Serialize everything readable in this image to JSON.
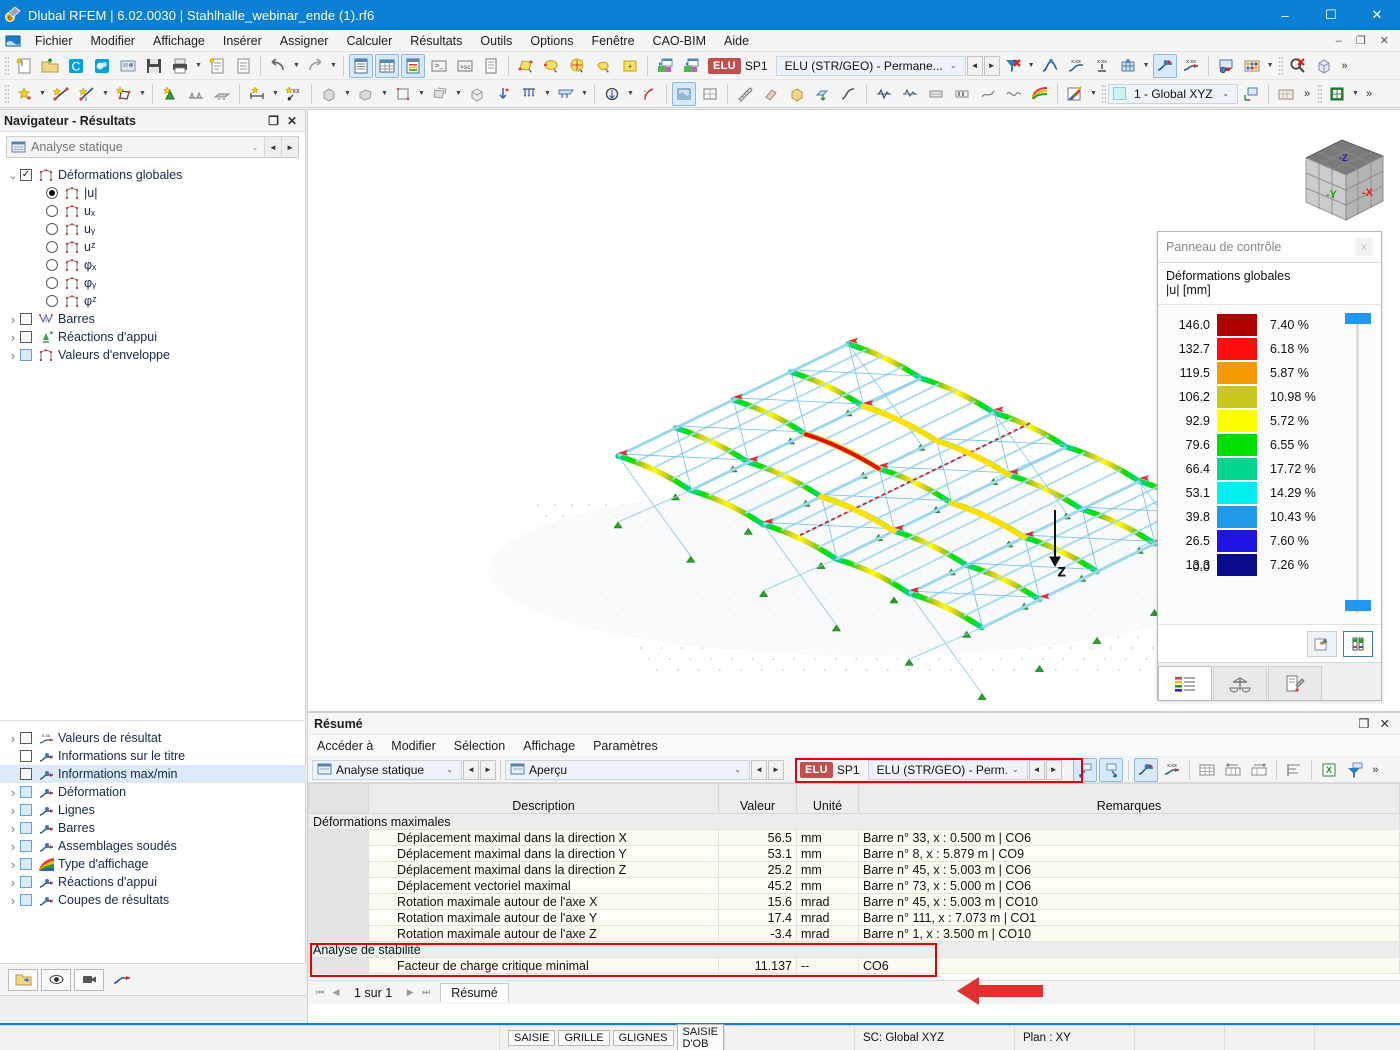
{
  "window": {
    "title": "Dlubal RFEM | 6.02.0030 | Stahlhalle_webinar_ende (1).rf6",
    "minimize": "–",
    "maximize": "☐",
    "close": "✕"
  },
  "menubar": {
    "items": [
      "Fichier",
      "Modifier",
      "Affichage",
      "Insérer",
      "Assigner",
      "Calculer",
      "Résultats",
      "Outils",
      "Options",
      "Fenêtre",
      "CAO-BIM",
      "Aide"
    ],
    "win_buttons": [
      "–",
      "❐",
      "✕"
    ]
  },
  "toolbar": {
    "load_badge": "ELU",
    "load_case": "SP1",
    "combination": "ELU (STR/GEO) - Permane...",
    "coord_system": "1 - Global XYZ",
    "prev_label": "◄",
    "next_label": "►",
    "chevron": "⌄",
    "overflow": "»"
  },
  "navigator": {
    "title": "Navigateur - Résultats",
    "restore_icon": "❐",
    "close_icon": "✕",
    "selector": "Analyse statique",
    "tree": [
      {
        "label": "Déformations globales",
        "type": "check",
        "checked": true,
        "expanded": true,
        "icon": "frame-icon",
        "indent": 0
      },
      {
        "label": "|u|",
        "type": "radio",
        "selected": true,
        "icon": "frame-icon",
        "indent": 1
      },
      {
        "label": "uₓ",
        "type": "radio",
        "selected": false,
        "icon": "frame-icon",
        "indent": 1
      },
      {
        "label": "uᵧ",
        "type": "radio",
        "selected": false,
        "icon": "frame-icon",
        "indent": 1
      },
      {
        "label": "uᶻ",
        "type": "radio",
        "selected": false,
        "icon": "frame-icon",
        "indent": 1
      },
      {
        "label": "φₓ",
        "type": "radio",
        "selected": false,
        "icon": "frame-icon",
        "indent": 1
      },
      {
        "label": "φᵧ",
        "type": "radio",
        "selected": false,
        "icon": "frame-icon",
        "indent": 1
      },
      {
        "label": "φᶻ",
        "type": "radio",
        "selected": false,
        "icon": "frame-icon",
        "indent": 1
      },
      {
        "label": "Barres",
        "type": "check",
        "checked": false,
        "expandable": true,
        "icon": "member-icon",
        "indent": 0
      },
      {
        "label": "Réactions d'appui",
        "type": "check",
        "checked": false,
        "expandable": true,
        "icon": "support-icon",
        "indent": 0
      },
      {
        "label": "Valeurs d'enveloppe",
        "type": "check",
        "checked": false,
        "blue": true,
        "expandable": true,
        "icon": "frame-icon",
        "indent": 0
      }
    ],
    "tree2": [
      {
        "label": "Valeurs de résultat",
        "expandable": true,
        "icon": "values-icon"
      },
      {
        "label": "Informations sur le titre",
        "expandable": false,
        "icon": "info-icon"
      },
      {
        "label": "Informations max/min",
        "expandable": false,
        "icon": "info-icon",
        "selected": true
      },
      {
        "label": "Déformation",
        "expandable": true,
        "icon": "info-icon",
        "blue": true
      },
      {
        "label": "Lignes",
        "expandable": true,
        "icon": "info-icon",
        "blue": true
      },
      {
        "label": "Barres",
        "expandable": true,
        "icon": "info-icon",
        "blue": true
      },
      {
        "label": "Assemblages soudés",
        "expandable": true,
        "icon": "info-icon",
        "blue": true
      },
      {
        "label": "Type d'affichage",
        "expandable": true,
        "icon": "rainbow-icon",
        "blue": true
      },
      {
        "label": "Réactions d'appui",
        "expandable": true,
        "icon": "info-icon",
        "blue": true
      },
      {
        "label": "Coupes de résultats",
        "expandable": true,
        "icon": "info-icon",
        "blue": true
      }
    ]
  },
  "control_panel": {
    "title": "Panneau de contrôle",
    "close_icon": "x",
    "heading_line1": "Déformations globales",
    "heading_line2": "|u| [mm]",
    "legend_values": [
      "146.0",
      "132.7",
      "119.5",
      "106.2",
      "92.9",
      "79.6",
      "66.4",
      "53.1",
      "39.8",
      "26.5",
      "13.3",
      "0.0"
    ],
    "legend_bands": [
      {
        "color": "#b00000",
        "percent": "7.40 %"
      },
      {
        "color": "#ff0d0d",
        "percent": "6.18 %"
      },
      {
        "color": "#f59a00",
        "percent": "5.87 %"
      },
      {
        "color": "#c8c81e",
        "percent": "10.98 %"
      },
      {
        "color": "#ffff00",
        "percent": "5.72 %"
      },
      {
        "color": "#00e000",
        "percent": "6.55 %"
      },
      {
        "color": "#00d68c",
        "percent": "17.72 %"
      },
      {
        "color": "#00f0f0",
        "percent": "14.29 %"
      },
      {
        "color": "#1e9ae6",
        "percent": "10.43 %"
      },
      {
        "color": "#1e14e6",
        "percent": "7.60 %"
      },
      {
        "color": "#0a0a8c",
        "percent": "7.26 %"
      }
    ],
    "slider_color": "#2196f3",
    "tabs": [
      "legend-tab",
      "scale-tab",
      "factors-tab"
    ]
  },
  "viewport": {
    "axis_labels": {
      "x": "X",
      "y": "Y",
      "z": "Z"
    },
    "load_arrow_label": "Z",
    "viewcube": {
      "left": "-Y",
      "right": "-X",
      "top": "-Z"
    }
  },
  "dock": {
    "title": "Résumé",
    "restore_icon": "❐",
    "close_icon": "✕",
    "menu": [
      "Accéder à",
      "Modifier",
      "Sélection",
      "Affichage",
      "Paramètres"
    ],
    "selector_left": "Analyse statique",
    "selector_mid": "Aperçu",
    "load_badge": "ELU",
    "load_case": "SP1",
    "combination": "ELU (STR/GEO) - Perm...",
    "columns": [
      "",
      "Description",
      "Valeur",
      "Unité",
      "Remarques"
    ],
    "group1": "Déformations maximales",
    "rows1": [
      {
        "description": "Déplacement maximal dans la direction X",
        "value": "56.5",
        "unit": "mm",
        "remark": "Barre n° 33, x : 0.500 m | CO6"
      },
      {
        "description": "Déplacement maximal dans la direction Y",
        "value": "53.1",
        "unit": "mm",
        "remark": "Barre n° 8, x : 5.879 m | CO9"
      },
      {
        "description": "Déplacement maximal dans la direction Z",
        "value": "25.2",
        "unit": "mm",
        "remark": "Barre n° 45, x : 5.003 m | CO6"
      },
      {
        "description": "Déplacement vectoriel maximal",
        "value": "45.2",
        "unit": "mm",
        "remark": "Barre n° 73, x : 5.000 m | CO6"
      },
      {
        "description": "Rotation maximale autour de l'axe X",
        "value": "15.6",
        "unit": "mrad",
        "remark": "Barre n° 45, x : 5.003 m | CO10"
      },
      {
        "description": "Rotation maximale autour de l'axe Y",
        "value": "17.4",
        "unit": "mrad",
        "remark": "Barre n° 111, x : 7.073 m | CO1"
      },
      {
        "description": "Rotation maximale autour de l'axe Z",
        "value": "-3.4",
        "unit": "mrad",
        "remark": "Barre n° 1, x : 3.500 m | CO10"
      }
    ],
    "group2": "Analyse de stabilité",
    "rows2": [
      {
        "description": "Facteur de charge critique minimal",
        "value": "11.137",
        "unit": "--",
        "remark": "CO6"
      }
    ],
    "pager": {
      "first": "⏮",
      "prev": "◀",
      "text": "1 sur 1",
      "next": "▶",
      "last": "⏭",
      "tab": "Résumé"
    },
    "highlight_color": "#e60000"
  },
  "statusbar": {
    "toggles": [
      "SAISIE",
      "GRILLE",
      "GLIGNES",
      "SAISIE D'OB"
    ],
    "coord_system": "SC: Global XYZ",
    "plane": "Plan : XY"
  }
}
